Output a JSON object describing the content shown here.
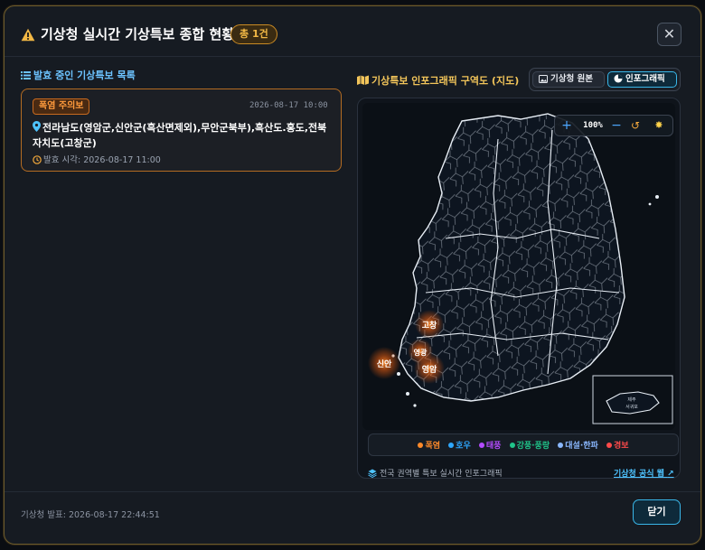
{
  "header": {
    "title": "기상청 실시간 기상특보 종합 현황",
    "count_badge": "총 1건",
    "close_label": "✕"
  },
  "alert_list": {
    "section_title": "발효 중인 기상특보 목록",
    "items": [
      {
        "badge": "폭염 주의보",
        "date": "2026-08-17 10:00",
        "region": "전라남도(영암군,신안군(흑산면제외),무안군북부),흑산도.홍도,전북자치도(고창군)",
        "issued": "발효 시각: 2026-08-17 11:00"
      }
    ]
  },
  "map_panel": {
    "section_title": "기상특보 인포그래픽 구역도 (지도)",
    "tabs": [
      {
        "label": "기상청 원본",
        "active": false
      },
      {
        "label": "인포그래픽",
        "active": true
      }
    ],
    "zoom": {
      "plus": "+",
      "level": "100%",
      "minus": "−",
      "reset": "↺",
      "theme": "✸"
    },
    "hotspots": [
      "고창",
      "영광",
      "신안",
      "영암"
    ],
    "inset_labels": [
      "제주",
      "서귀포"
    ],
    "legend": [
      {
        "label": "폭염",
        "color": "#ff8a2a"
      },
      {
        "label": "호우",
        "color": "#2ea8ff"
      },
      {
        "label": "태풍",
        "color": "#b44cff"
      },
      {
        "label": "강풍·풍랑",
        "color": "#20c58a"
      },
      {
        "label": "대설·한파",
        "color": "#8ab8ff"
      },
      {
        "label": "경보",
        "color": "#ff4a4a"
      }
    ],
    "caption": "전국 권역별 특보 실시간 인포그래픽",
    "link": "기상청 공식 웹"
  },
  "footer": {
    "announced": "기상청 발표: 2026-08-17 22:44:51",
    "confirm": "닫기"
  },
  "colors": {
    "accent": "#39b6e8",
    "warning": "#f2b845",
    "heat": "#ff8a2a"
  }
}
